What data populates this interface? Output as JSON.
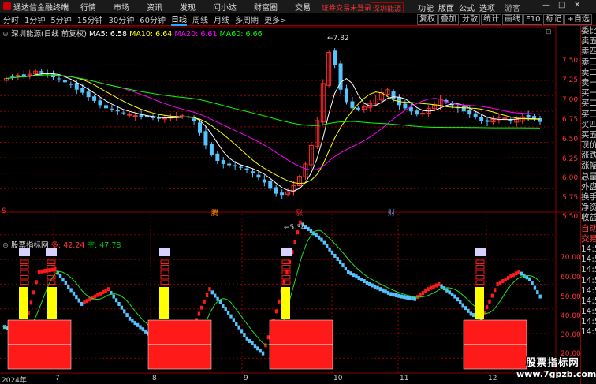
{
  "menubar": {
    "app_title": "通达信金融终端",
    "menus": [
      "行情",
      "市场",
      "资讯",
      "发现",
      "问小达",
      "财富圈",
      "交易"
    ],
    "notice": "证券交易未登录",
    "stock_link": "深圳能源",
    "right_menus": [
      "功能",
      "版面",
      "公式",
      "选项"
    ],
    "user": "游客"
  },
  "periods": [
    "分时",
    "1分钟",
    "5分钟",
    "15分钟",
    "30分钟",
    "60分钟",
    "日线",
    "周线",
    "月线",
    "多周期",
    "更多"
  ],
  "active_period": "日线",
  "toolbar": [
    "复权",
    "叠加",
    "分散",
    "统计",
    "画线",
    "F10",
    "标记",
    "+自选"
  ],
  "main_chart": {
    "stock_name": "深圳能源(日线 前复权)",
    "ma5_label": "MA5: 6.58",
    "ma10_label": "MA10: 6.64",
    "ma20_label": "MA20: 6.61",
    "ma60_label": "MA60: 6.66",
    "high_label": "7.82",
    "low_label": "5.34",
    "price_ticks": [
      "7.50",
      "7.25",
      "7.00",
      "6.75",
      "6.50",
      "6.25",
      "6.00",
      "5.75",
      "5.50"
    ],
    "events": [
      "腾",
      "涨",
      "财"
    ]
  },
  "indicator": {
    "name": "股票指标网",
    "duo_label": "多: 42.24",
    "kong_label": "空: 47.78",
    "ticks": [
      "70.00",
      "60.00",
      "50.00",
      "40.00",
      "30.00",
      "20.00"
    ]
  },
  "xaxis": [
    "2024年",
    "7",
    "8",
    "9",
    "10",
    "11",
    "12"
  ],
  "right_panel": [
    "委比",
    "卖五",
    "卖四",
    "卖三",
    "卖二",
    "卖一",
    "买一",
    "买二",
    "买三",
    "买四",
    "买五",
    "现价",
    "涨跌",
    "涨幅",
    "总量",
    "外盘",
    "换手",
    "净资",
    "收益",
    "自动",
    "交易",
    "14:50",
    "14:50",
    "14:50",
    "14:50",
    "14:50",
    "14:50",
    "14:50",
    "14:50",
    "14:50"
  ],
  "watermark": {
    "line1": "股票指标网",
    "line2": "www.7gpzb.com"
  },
  "colors": {
    "up": "#ff3333",
    "down": "#54c4ff",
    "ma5": "#ffffff",
    "ma10": "#ffff00",
    "ma20": "#ff00ff",
    "ma60": "#00ff00",
    "grid": "#8b0000"
  },
  "chart_data": {
    "type": "candlestick",
    "price_range": [
      5.34,
      7.82
    ],
    "closes": [
      7.28,
      7.3,
      7.33,
      7.32,
      7.35,
      7.4,
      7.38,
      7.36,
      7.3,
      7.28,
      7.22,
      7.18,
      7.1,
      7.05,
      6.98,
      6.92,
      6.85,
      6.8,
      6.78,
      6.75,
      6.72,
      6.7,
      6.68,
      6.66,
      6.65,
      6.64,
      6.63,
      6.64,
      6.66,
      6.67,
      6.68,
      6.66,
      6.6,
      6.4,
      6.2,
      6.05,
      5.95,
      5.9,
      5.88,
      5.86,
      5.84,
      5.8,
      5.75,
      5.68,
      5.6,
      5.5,
      5.42,
      5.4,
      5.45,
      5.55,
      5.7,
      5.9,
      6.2,
      6.6,
      7.2,
      7.7,
      7.5,
      7.1,
      6.9,
      6.8,
      6.78,
      6.82,
      6.88,
      6.95,
      7.05,
      7.1,
      6.95,
      6.85,
      6.8,
      6.75,
      6.7,
      6.72,
      6.8,
      6.85,
      6.95,
      6.9,
      6.85,
      6.8,
      6.75,
      6.7,
      6.65,
      6.6,
      6.58,
      6.62,
      6.65,
      6.64,
      6.6,
      6.62,
      6.66,
      6.65,
      6.62,
      6.58
    ]
  }
}
